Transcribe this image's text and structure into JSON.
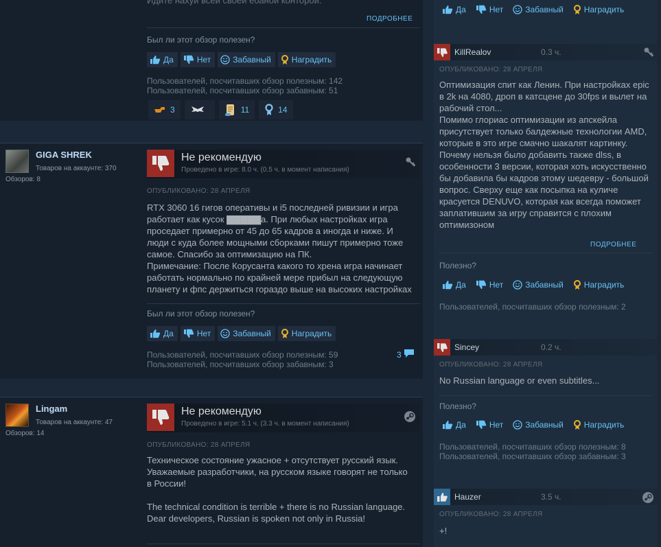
{
  "review1": {
    "truncated_line": "Идите нахуй всей своей ебаной конторой.",
    "more": "ПОДРОБНЕЕ",
    "helpful_question": "Был ли этот обзор полезен?",
    "buttons": {
      "yes": "Да",
      "no": "Нет",
      "funny": "Забавный",
      "award": "Наградить"
    },
    "helpful_count": "Пользователей, посчитавших обзор полезным: 142",
    "funny_count": "Пользователей, посчитавших обзор забавным: 51",
    "awards": [
      {
        "icon": "hand-point-award-icon",
        "count": "3"
      },
      {
        "icon": "wings-award-icon",
        "count": ""
      },
      {
        "icon": "scroll-award-icon",
        "count": "11"
      },
      {
        "icon": "medal-award-icon",
        "count": "14"
      }
    ]
  },
  "review2": {
    "author": "GIGA SHREK",
    "games": "Товаров на аккаунте: 370",
    "reviews": "Обзоров: 8",
    "verdict": "Не рекомендую",
    "hours": "Проведено в игре: 8.0 ч. (0.5 ч. в момент написания)",
    "posted": "ОПУБЛИКОВАНО: 28 АПРЕЛЯ",
    "text": "RTX 3060 16 гигов оперативы и i5 последней ривизии и игра работает как кусок ▇▇▇▇▇а. При любых настройках игра проседает примерно от 45 до 65 кадров а иногда и ниже. И люди с куда более мощными сборками пишут примерно тоже самое. Спасибо за оптимизацию на ПК.\nПримечание: После Корусанта какого то хрена игра начинает работать нормально по крайней мере прибыл на следующую планету и фпс держиться гораздо выше на высоких настройках",
    "helpful_question": "Был ли этот обзор полезен?",
    "buttons": {
      "yes": "Да",
      "no": "Нет",
      "funny": "Забавный",
      "award": "Наградить"
    },
    "helpful_count": "Пользователей, посчитавших обзор полезным: 59",
    "funny_count": "Пользователей, посчитавших обзор забавным: 3",
    "comments": "3"
  },
  "review3": {
    "author": "Lingam",
    "games": "Товаров на аккаунте: 47",
    "reviews": "Обзоров: 14",
    "verdict": "Не рекомендую",
    "hours": "Проведено в игре: 5.1 ч. (3.3 ч. в момент написания)",
    "posted": "ОПУБЛИКОВАНО: 28 АПРЕЛЯ",
    "text": "Техническое состояние ужасное + отсутствует русский язык. Уважаемые разработчики, на русском языке говорят не только в России!\n\nThe technical condition is terrible + there is no Russian language.\nDear developers, Russian is spoken not only in Russia!"
  },
  "side_top": {
    "buttons": {
      "yes": "Да",
      "no": "Нет",
      "funny": "Забавный",
      "award": "Наградить"
    }
  },
  "side1": {
    "author": "KillRealov",
    "hours": "0.3 ч.",
    "posted": "ОПУБЛИКОВАНО: 28 АПРЕЛЯ",
    "text": "Оптимизация спит как Ленин. При настройках epic в 2k на 4080, дроп в катсцене до 30fps и вылет на рабочий стол...\nПомимо глориас оптимизации из апскейла присутствует только балдежные технологии AMD, которые в это игре смачно шакалят картинку. Почему нельзя было добавить также dlss, в особенности 3 версии, которая хоть искусственно бы добавила бы кадров этому шедевру - большой вопрос. Сверху еще как посыпка на куличе красуется DENUVO, которая как всегда поможет заплатившим за игру справится с плохим оптимизоном",
    "more": "ПОДРОБНЕЕ",
    "helpful_question": "Полезно?",
    "buttons": {
      "yes": "Да",
      "no": "Нет",
      "funny": "Забавный",
      "award": "Наградить"
    },
    "helpful_count": "Пользователей, посчитавших обзор полезным: 2"
  },
  "side2": {
    "author": "Sincey",
    "hours": "0.2 ч.",
    "posted": "ОПУБЛИКОВАНО: 28 АПРЕЛЯ",
    "text": "No Russian language or even subtitles...",
    "helpful_question": "Полезно?",
    "buttons": {
      "yes": "Да",
      "no": "Нет",
      "funny": "Забавный",
      "award": "Наградить"
    },
    "helpful_count": "Пользователей, посчитавших обзор полезным: 8",
    "funny_count": "Пользователей, посчитавших обзор забавным: 3"
  },
  "side3": {
    "author": "Hauzer",
    "hours": "3.5 ч.",
    "posted": "ОПУБЛИКОВАНО: 28 АПРЕЛЯ",
    "text": "+!"
  },
  "colors": {
    "link": "#67c1f5",
    "thumb_down": "#9b2b25",
    "thumb_up": "#2f6892",
    "bg": "#1b2838"
  }
}
